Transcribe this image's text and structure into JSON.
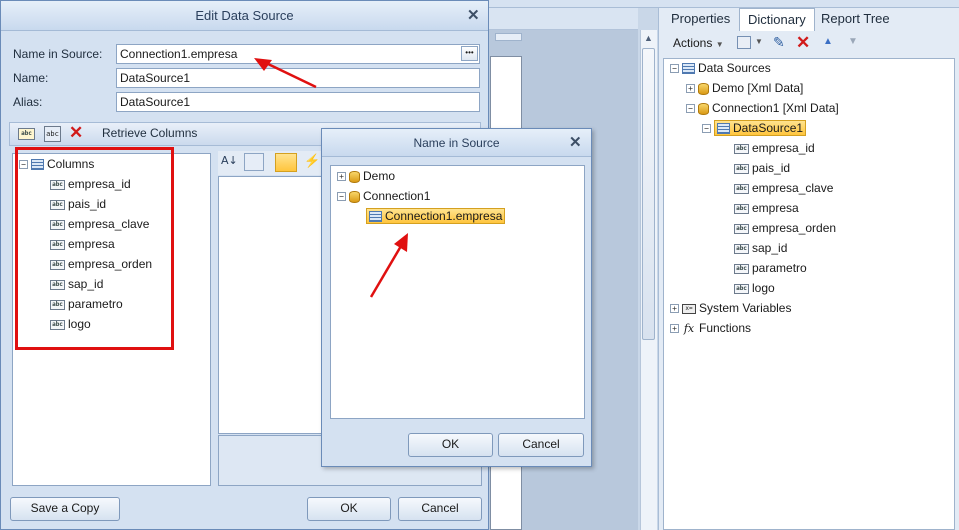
{
  "right_panel": {
    "tabs": [
      "Properties",
      "Dictionary",
      "Report Tree"
    ],
    "active_tab": "Dictionary",
    "actions_label": "Actions",
    "tree": {
      "data_sources": "Data Sources",
      "demo": "Demo [Xml Data]",
      "connection1": "Connection1 [Xml Data]",
      "datasource1": "DataSource1",
      "columns": [
        "empresa_id",
        "pais_id",
        "empresa_clave",
        "empresa",
        "empresa_orden",
        "sap_id",
        "parametro",
        "logo"
      ],
      "system_variables": "System Variables",
      "functions": "Functions"
    }
  },
  "edit_dialog": {
    "title": "Edit Data Source",
    "name_in_source_label": "Name in Source:",
    "name_in_source_value": "Connection1.empresa",
    "name_label": "Name:",
    "name_value": "DataSource1",
    "alias_label": "Alias:",
    "alias_value": "DataSource1",
    "retrieve_columns": "Retrieve Columns",
    "columns_root": "Columns",
    "columns": [
      "empresa_id",
      "pais_id",
      "empresa_clave",
      "empresa",
      "empresa_orden",
      "sap_id",
      "parametro",
      "logo"
    ],
    "save_copy": "Save a Copy",
    "ok": "OK",
    "cancel": "Cancel"
  },
  "name_dialog": {
    "title": "Name in Source",
    "tree": {
      "demo": "Demo",
      "connection1": "Connection1",
      "selected": "Connection1.empresa"
    },
    "ok": "OK",
    "cancel": "Cancel"
  },
  "colors": {
    "highlight_box": "#e01010",
    "selection": "#ffc53d"
  }
}
